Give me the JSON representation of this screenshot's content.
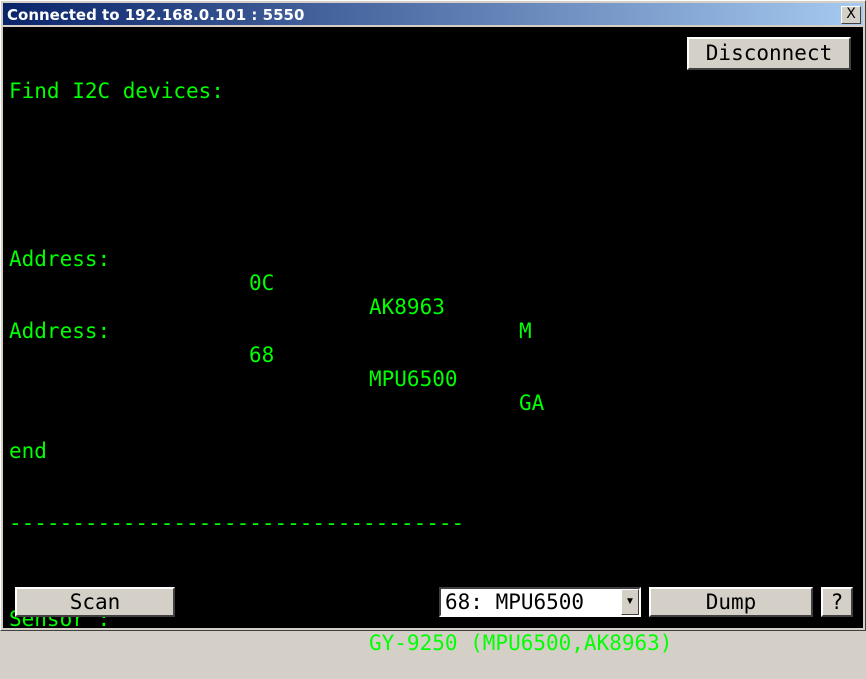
{
  "window": {
    "title": "Connected to 192.168.0.101 : 5550",
    "close_label": "X"
  },
  "console": {
    "heading": "Find I2C devices:",
    "rows": [
      {
        "label": "Address:",
        "addr": "0C",
        "chip": "AK8963",
        "type": "M"
      },
      {
        "label": "Address:",
        "addr": "68",
        "chip": "MPU6500",
        "type": "GA"
      }
    ],
    "end": "end",
    "separator": "------------------------------------",
    "sensor_label": "Sensor :",
    "sensor_value": "GY-9250 (MPU6500,AK8963)"
  },
  "buttons": {
    "disconnect": "Disconnect",
    "scan": "Scan",
    "dump": "Dump",
    "help": "?"
  },
  "device_select": {
    "value": "68: MPU6500"
  },
  "colors": {
    "terminal_bg": "#000000",
    "terminal_fg": "#00ff00",
    "titlebar": "#0a246a"
  }
}
